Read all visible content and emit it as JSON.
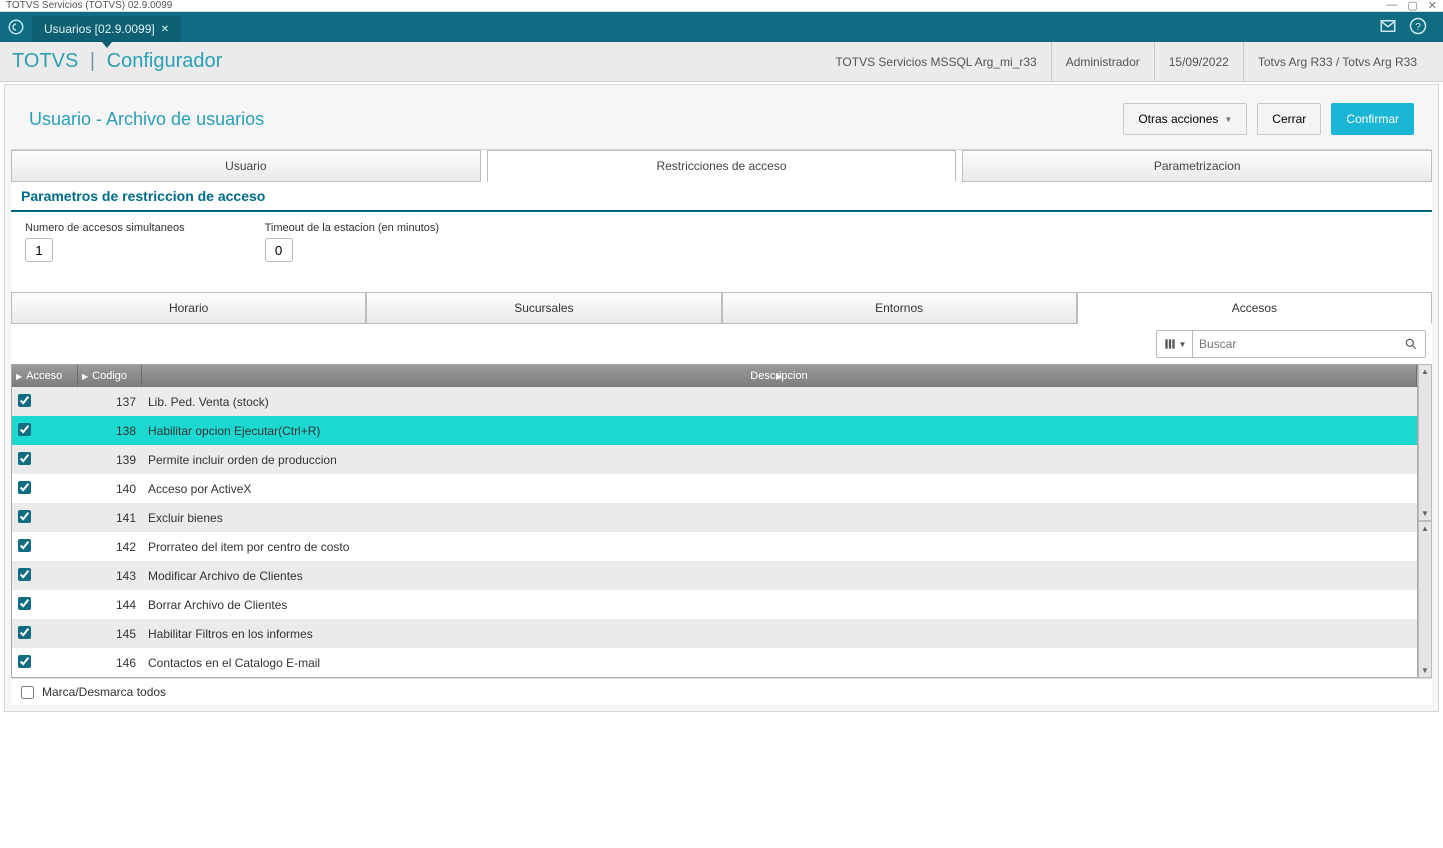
{
  "window": {
    "title_fragment": "TOTVS Servicios (TOTVS) 02.9.0099"
  },
  "header": {
    "tab_label": "Usuarios [02.9.0099]"
  },
  "breadcrumb": {
    "brand_left": "TOTVS",
    "brand_right": "Configurador"
  },
  "status": {
    "env": "TOTVS Servicios MSSQL Arg_mi_r33",
    "user": "Administrador",
    "date": "15/09/2022",
    "instance": "Totvs Arg R33 / Totvs Arg R33"
  },
  "page": {
    "title": "Usuario - Archivo de usuarios",
    "btn_other": "Otras acciones",
    "btn_close": "Cerrar",
    "btn_confirm": "Confirmar"
  },
  "top_tabs": {
    "usuario": "Usuario",
    "restricciones": "Restricciones de acceso",
    "parametrizacion": "Parametrizacion"
  },
  "section_title": "Parametros de restriccion de acceso",
  "params": {
    "accesos_label": "Numero de accesos simultaneos",
    "accesos_value": "1",
    "timeout_label": "Timeout de la estacion (en minutos)",
    "timeout_value": "0"
  },
  "sub_tabs": {
    "horario": "Horario",
    "sucursales": "Sucursales",
    "entornos": "Entornos",
    "accesos": "Accesos"
  },
  "search": {
    "placeholder": "Buscar"
  },
  "grid": {
    "col_acceso": "Acceso",
    "col_codigo": "Codigo",
    "col_desc": "Descripcion",
    "rows": [
      {
        "checked": true,
        "code": "137",
        "desc": "Lib. Ped. Venta (stock)"
      },
      {
        "checked": true,
        "code": "138",
        "desc": "Habilitar opcion Ejecutar(Ctrl+R)",
        "selected": true
      },
      {
        "checked": true,
        "code": "139",
        "desc": "Permite incluir orden de produccion"
      },
      {
        "checked": true,
        "code": "140",
        "desc": "Acceso por ActiveX"
      },
      {
        "checked": true,
        "code": "141",
        "desc": "Excluir bienes"
      },
      {
        "checked": true,
        "code": "142",
        "desc": "Prorrateo del item por centro de costo"
      },
      {
        "checked": true,
        "code": "143",
        "desc": "Modificar Archivo de Clientes"
      },
      {
        "checked": true,
        "code": "144",
        "desc": "Borrar Archivo de Clientes"
      },
      {
        "checked": true,
        "code": "145",
        "desc": "Habilitar Filtros en los informes"
      },
      {
        "checked": true,
        "code": "146",
        "desc": "Contactos en el Catalogo E-mail"
      }
    ],
    "mark_all": "Marca/Desmarca todos"
  }
}
